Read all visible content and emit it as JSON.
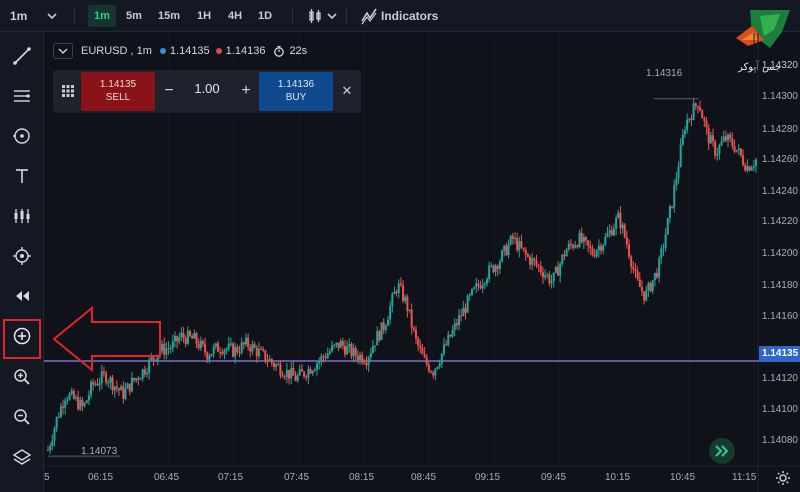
{
  "toolbar": {
    "timeframe_selector": "1m",
    "timeframes": [
      "1m",
      "5m",
      "15m",
      "1H",
      "4H",
      "1D"
    ],
    "active_timeframe": "1m",
    "indicators_label": "Indicators"
  },
  "symbol": {
    "name": "EURUSD , 1m",
    "bid": "1.14135",
    "ask": "1.14136",
    "timer": "22s"
  },
  "trade": {
    "sell_price": "1.14135",
    "sell_label": "SELL",
    "quantity": "1.00",
    "buy_price": "1.14136",
    "buy_label": "BUY",
    "minus": "−",
    "plus": "+",
    "close": "✕"
  },
  "price_axis": {
    "labels": [
      "1.14320",
      "1.14300",
      "1.14280",
      "1.14260",
      "1.14240",
      "1.14220",
      "1.14200",
      "1.14180",
      "1.14160",
      "1.14120",
      "1.14100",
      "1.14080"
    ],
    "current": "1.14135",
    "high_marker": "1.14316",
    "low_marker": "1.14073"
  },
  "time_axis": {
    "labels": [
      "06:15",
      "06:45",
      "07:15",
      "07:45",
      "08:15",
      "08:45",
      "09:15",
      "09:45",
      "10:15",
      "10:45",
      "11:15"
    ],
    "edge": "5"
  },
  "logo_text": "جس آپوکر",
  "colors": {
    "up": "#26a69a",
    "down": "#ef5350",
    "accent": "#2ecc8f",
    "arrow": "#e0252b"
  },
  "left_tools": [
    "trendline-icon",
    "horizontal-lines-icon",
    "ray-icon",
    "text-icon",
    "pattern-icon",
    "target-icon",
    "rewind-icon",
    "add-icon",
    "zoom-in-icon",
    "zoom-out-icon",
    "layers-icon"
  ],
  "chart_data": {
    "type": "candlestick",
    "x_range": [
      "06:00",
      "11:20"
    ],
    "y_range": [
      1.1407,
      1.1432
    ],
    "current_price": 1.14135,
    "high": 1.14316,
    "low": 1.14073,
    "path": [
      [
        0,
        1.14073
      ],
      [
        4,
        1.14095
      ],
      [
        8,
        1.14112
      ],
      [
        12,
        1.14108
      ],
      [
        16,
        1.14102
      ],
      [
        20,
        1.14118
      ],
      [
        26,
        1.14125
      ],
      [
        30,
        1.14118
      ],
      [
        34,
        1.14112
      ],
      [
        38,
        1.1412
      ],
      [
        44,
        1.1413
      ],
      [
        50,
        1.14142
      ],
      [
        56,
        1.14145
      ],
      [
        60,
        1.14152
      ],
      [
        66,
        1.1415
      ],
      [
        72,
        1.1414
      ],
      [
        78,
        1.14145
      ],
      [
        84,
        1.14142
      ],
      [
        90,
        1.14147
      ],
      [
        96,
        1.1414
      ],
      [
        102,
        1.14133
      ],
      [
        108,
        1.14127
      ],
      [
        112,
        1.14123
      ],
      [
        116,
        1.14127
      ],
      [
        120,
        1.14132
      ],
      [
        126,
        1.1414
      ],
      [
        132,
        1.14147
      ],
      [
        138,
        1.1414
      ],
      [
        144,
        1.14137
      ],
      [
        148,
        1.1415
      ],
      [
        152,
        1.1416
      ],
      [
        158,
        1.14188
      ],
      [
        162,
        1.14175
      ],
      [
        166,
        1.1415
      ],
      [
        170,
        1.14135
      ],
      [
        174,
        1.14128
      ],
      [
        178,
        1.1414
      ],
      [
        186,
        1.14165
      ],
      [
        192,
        1.14182
      ],
      [
        198,
        1.14195
      ],
      [
        204,
        1.14205
      ],
      [
        210,
        1.1422
      ],
      [
        216,
        1.14208
      ],
      [
        222,
        1.142
      ],
      [
        228,
        1.1419
      ],
      [
        234,
        1.14212
      ],
      [
        240,
        1.1422
      ],
      [
        246,
        1.1421
      ],
      [
        252,
        1.1422
      ],
      [
        258,
        1.14235
      ],
      [
        262,
        1.14215
      ],
      [
        266,
        1.1419
      ],
      [
        270,
        1.1418
      ],
      [
        276,
        1.142
      ],
      [
        282,
        1.14245
      ],
      [
        288,
        1.143
      ],
      [
        294,
        1.14316
      ],
      [
        298,
        1.14292
      ],
      [
        302,
        1.1428
      ],
      [
        306,
        1.1429
      ],
      [
        310,
        1.14285
      ],
      [
        316,
        1.1427
      ],
      [
        320,
        1.14275
      ]
    ]
  }
}
